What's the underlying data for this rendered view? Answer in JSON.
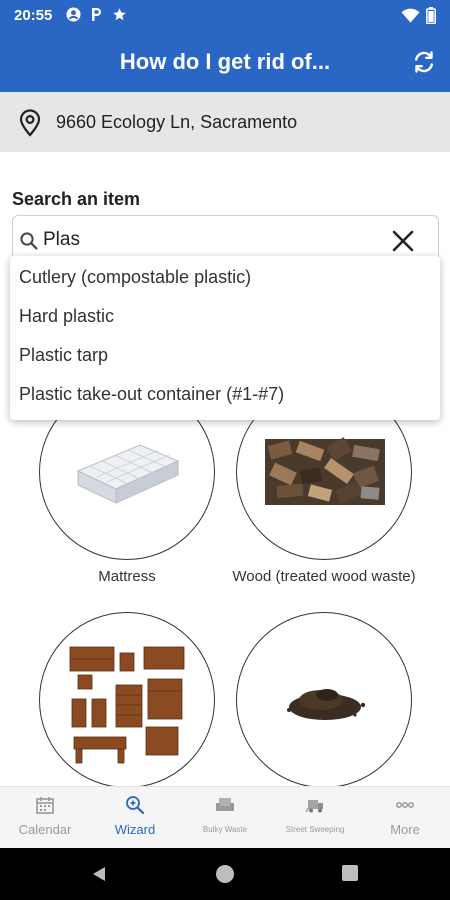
{
  "status_bar": {
    "time": "20:55",
    "icons": [
      "account-circle-icon",
      "parking-icon",
      "star-icon"
    ],
    "right_icons": [
      "wifi-icon",
      "battery-icon"
    ]
  },
  "app_bar": {
    "title": "How do I get rid of...",
    "refresh_icon": "refresh-icon",
    "color": "#2a66c4"
  },
  "address": {
    "icon": "location-pin-icon",
    "text": "9660 Ecology Ln, Sacramento"
  },
  "search": {
    "label": "Search an item",
    "value": "Plas",
    "clear_icon": "close-icon",
    "suggestions": [
      "Cutlery (compostable plastic)",
      "Hard plastic",
      "Plastic tarp",
      "Plastic take-out container (#1-#7)"
    ]
  },
  "items": [
    {
      "label": "Mattress",
      "image": "mattress-image"
    },
    {
      "label": "Wood (treated wood waste)",
      "image": "wood-image"
    },
    {
      "label": "",
      "image": "furniture-image"
    },
    {
      "label": "",
      "image": "soil-image"
    }
  ],
  "bottom_nav": {
    "items": [
      {
        "label": "Calendar",
        "icon": "calendar-icon",
        "active": false
      },
      {
        "label": "Wizard",
        "icon": "wizard-search-icon",
        "active": true
      },
      {
        "label": "Bulky Waste",
        "icon": "couch-icon",
        "active": false
      },
      {
        "label": "Street Sweeping",
        "icon": "sweeper-truck-icon",
        "active": false
      },
      {
        "label": "More",
        "icon": "more-dots-icon",
        "active": false
      }
    ],
    "active_color": "#2a66c4"
  },
  "system_nav": [
    "back-icon",
    "home-icon",
    "recents-icon"
  ]
}
